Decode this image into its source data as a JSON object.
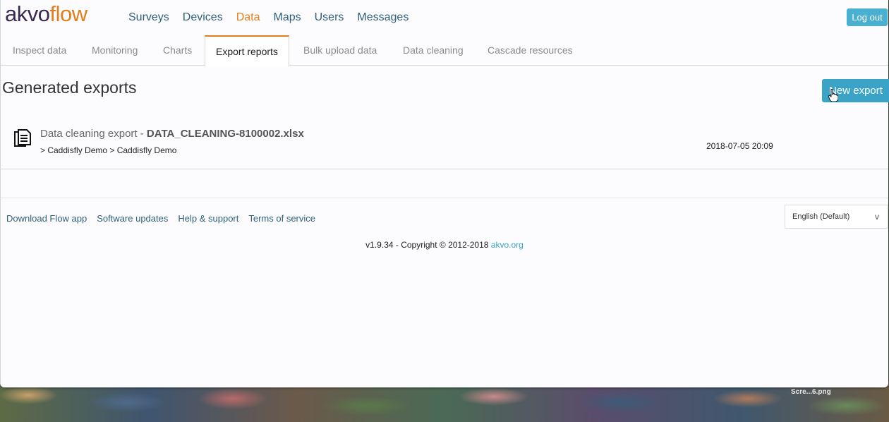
{
  "header": {
    "logo_part1": "akvo",
    "logo_part2": "flow",
    "nav": [
      "Surveys",
      "Devices",
      "Data",
      "Maps",
      "Users",
      "Messages"
    ],
    "active_nav": "Data",
    "logout_label": "Log out"
  },
  "subtabs": {
    "items": [
      "Inspect data",
      "Monitoring",
      "Charts",
      "Export reports",
      "Bulk upload data",
      "Data cleaning",
      "Cascade resources"
    ],
    "active": "Export reports"
  },
  "main": {
    "title": "Generated exports",
    "new_export_label": "New export",
    "exports": [
      {
        "type_label": "Data cleaning export - ",
        "filename": "DATA_CLEANING-8100002.xlsx",
        "path": "> Caddisfly Demo > Caddisfly Demo",
        "date": "2018-07-05 20:09"
      }
    ]
  },
  "footer": {
    "links": [
      "Download Flow app",
      "Software updates",
      "Help & support",
      "Terms of service"
    ],
    "language": "English (Default)",
    "language_chevron": "v",
    "copyright_text": "v1.9.34 - Copyright © 2012-2018 ",
    "copyright_link": "akvo.org"
  },
  "desktop": {
    "file_label": "Scre...6.png"
  },
  "colors": {
    "brand_orange": "#e37f1c",
    "brand_purple": "#3b2a4f",
    "button_blue": "#3aa3c6",
    "link_blue": "#2f5f7a"
  }
}
